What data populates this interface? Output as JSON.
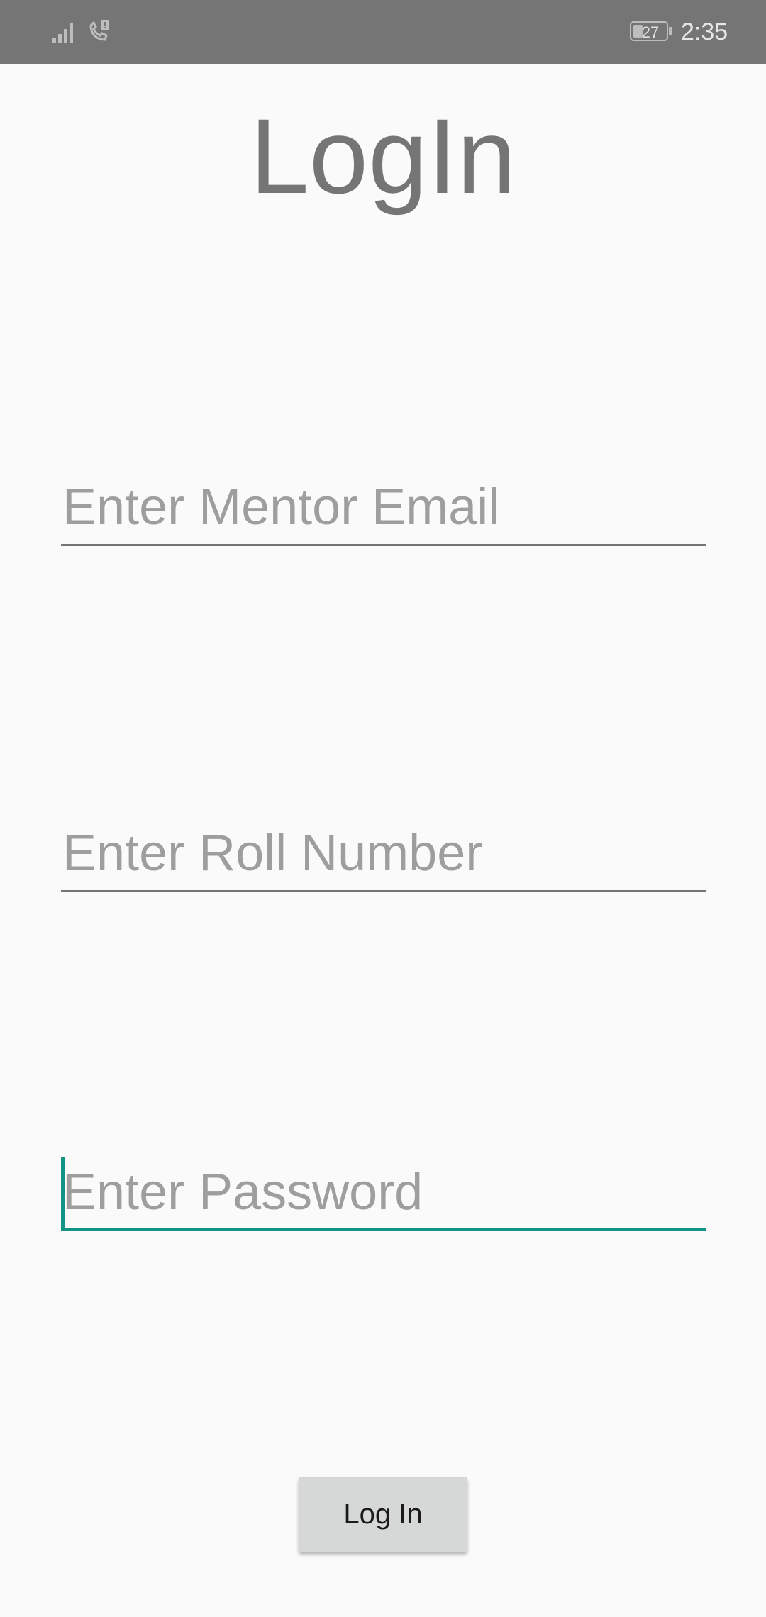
{
  "status_bar": {
    "battery_level": "27",
    "time": "2:35",
    "icons": [
      "signal-icon",
      "call-icon",
      "battery-icon"
    ]
  },
  "page": {
    "title": "LogIn"
  },
  "form": {
    "email": {
      "value": "",
      "placeholder": "Enter Mentor Email"
    },
    "roll_number": {
      "value": "",
      "placeholder": "Enter Roll Number"
    },
    "password": {
      "value": "",
      "placeholder": "Enter Password",
      "focused": true
    },
    "submit_label": "Log In"
  },
  "colors": {
    "status_bar": "#757575",
    "background": "#fafafa",
    "accent": "#129385",
    "title": "#757575",
    "placeholder": "#9e9e9e",
    "button": "#d6d7d7"
  }
}
